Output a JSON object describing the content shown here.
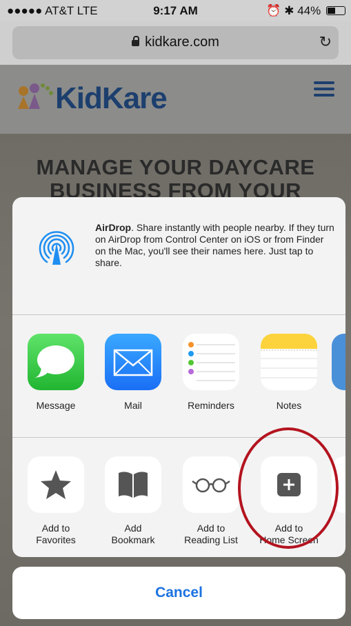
{
  "status": {
    "carrier": "●●●●● AT&T  LTE",
    "time": "9:17 AM",
    "battery": "44%",
    "battery_level": 0.44
  },
  "browser": {
    "url": "kidkare.com"
  },
  "site": {
    "logo_text": "KidKare",
    "hero_line1": "MANAGE YOUR DAYCARE",
    "hero_line2": "BUSINESS FROM YOUR"
  },
  "share_sheet": {
    "airdrop_title": "AirDrop",
    "airdrop_body": ". Share instantly with people nearby. If they turn on AirDrop from Control Center on iOS or from Finder on the Mac, you'll see their names here. Just tap to share.",
    "apps": [
      {
        "label": "Message",
        "icon": "message-icon"
      },
      {
        "label": "Mail",
        "icon": "mail-icon"
      },
      {
        "label": "Reminders",
        "icon": "reminders-icon"
      },
      {
        "label": "Notes",
        "icon": "notes-icon"
      }
    ],
    "actions": [
      {
        "line1": "Add to",
        "line2": "Favorites",
        "icon": "star-icon"
      },
      {
        "line1": "Add",
        "line2": "Bookmark",
        "icon": "book-icon"
      },
      {
        "line1": "Add to",
        "line2": "Reading List",
        "icon": "glasses-icon"
      },
      {
        "line1": "Add to",
        "line2": "Home Screen",
        "icon": "plus-square-icon"
      }
    ],
    "cancel_label": "Cancel"
  },
  "colors": {
    "accent": "#1b72e0",
    "brand": "#1c3f6e",
    "highlight": "#b3141f"
  }
}
